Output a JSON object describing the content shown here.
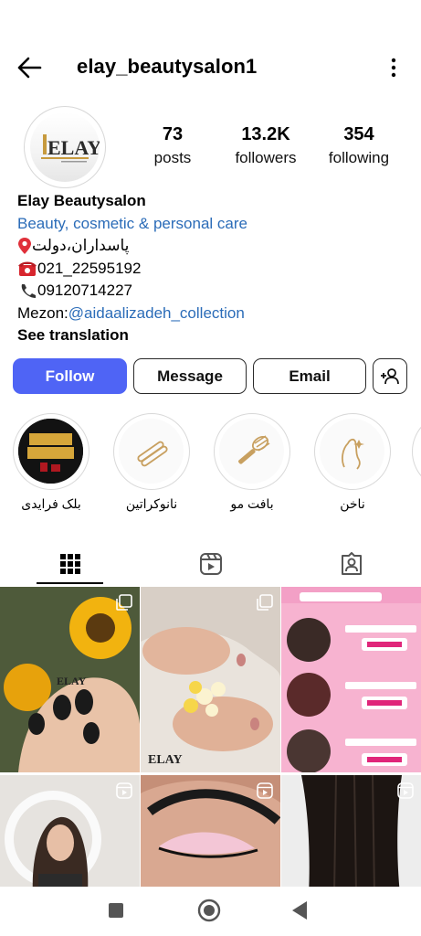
{
  "header": {
    "username": "elay_beautysalon1",
    "back_icon": "arrow-left-icon",
    "menu_icon": "more-vertical-icon"
  },
  "profile": {
    "avatar_logo_text": "ELAY",
    "stats": {
      "posts": {
        "value": "73",
        "label": "posts"
      },
      "followers": {
        "value": "13.2K",
        "label": "followers"
      },
      "following": {
        "value": "354",
        "label": "following"
      }
    },
    "bio": {
      "name": "Elay Beautysalon",
      "category": "Beauty, cosmetic & personal care",
      "address": "پاسداران،دولت",
      "phone1": "021_22595192",
      "phone2": "09120714227",
      "mezon_prefix": "Mezon:",
      "mezon_link": "@aidaalizadeh_collection",
      "see_translation": "See translation"
    }
  },
  "actions": {
    "follow": "Follow",
    "message": "Message",
    "email": "Email",
    "add_user_icon": "add-user-icon"
  },
  "highlights": [
    {
      "label": "بلک فرایدی",
      "icon": "black-friday-image"
    },
    {
      "label": "نانوکراتین",
      "icon": "hair-straightener-icon"
    },
    {
      "label": "بافت مو",
      "icon": "comb-icon"
    },
    {
      "label": "ناخن",
      "icon": "nail-hand-icon"
    }
  ],
  "tabs": [
    {
      "name": "grid",
      "icon": "grid-icon",
      "active": true
    },
    {
      "name": "reels",
      "icon": "reels-icon",
      "active": false
    },
    {
      "name": "tagged",
      "icon": "tagged-user-icon",
      "active": false
    }
  ],
  "posts": [
    {
      "type": "carousel",
      "watermark": "ELAY"
    },
    {
      "type": "carousel",
      "watermark": "ELAY"
    },
    {
      "type": "carousel"
    },
    {
      "type": "reel"
    },
    {
      "type": "reel"
    },
    {
      "type": "reel"
    }
  ],
  "colors": {
    "follow_button": "#4f64f5",
    "link": "#2b6cb8",
    "pink_banner": "#f9b6d3"
  },
  "system_nav": [
    "recent-apps-icon",
    "home-icon",
    "back-icon"
  ]
}
